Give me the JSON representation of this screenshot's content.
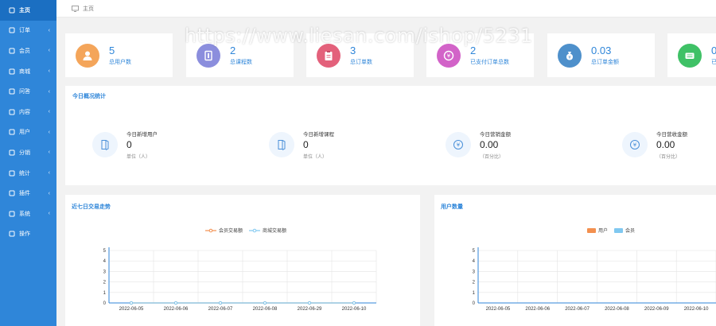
{
  "sidebar": {
    "items": [
      {
        "label": "主页",
        "icon": "home-icon",
        "active": true,
        "arrow": false
      },
      {
        "label": "订单",
        "icon": "list-icon",
        "active": false,
        "arrow": true
      },
      {
        "label": "会员",
        "icon": "user-icon",
        "active": false,
        "arrow": true
      },
      {
        "label": "商城",
        "icon": "tag-icon",
        "active": false,
        "arrow": true
      },
      {
        "label": "问答",
        "icon": "chat-icon",
        "active": false,
        "arrow": true
      },
      {
        "label": "内容",
        "icon": "flag-icon",
        "active": false,
        "arrow": true
      },
      {
        "label": "用户",
        "icon": "person-icon",
        "active": false,
        "arrow": true
      },
      {
        "label": "分销",
        "icon": "send-icon",
        "active": false,
        "arrow": true
      },
      {
        "label": "统计",
        "icon": "gear-icon",
        "active": false,
        "arrow": true
      },
      {
        "label": "插件",
        "icon": "plugin-icon",
        "active": false,
        "arrow": true
      },
      {
        "label": "系统",
        "icon": "settings-icon",
        "active": false,
        "arrow": true
      },
      {
        "label": "操作",
        "icon": "refresh-icon",
        "active": false,
        "arrow": false
      }
    ],
    "arrow_glyph": "‹"
  },
  "breadcrumb": {
    "label": "主页"
  },
  "watermark": "https://www.liesan.com/ishop/5231",
  "stats": [
    {
      "value": "5",
      "label": "总用户数",
      "color": "#f4a55a",
      "icon": "user-avatar-icon"
    },
    {
      "value": "2",
      "label": "总课程数",
      "color": "#8b8edd",
      "icon": "book-icon"
    },
    {
      "value": "3",
      "label": "总订单数",
      "color": "#e3617b",
      "icon": "clipboard-icon"
    },
    {
      "value": "2",
      "label": "已支付订单总数",
      "color": "#d263c8",
      "icon": "coin-icon"
    },
    {
      "value": "0.03",
      "label": "总订单金额",
      "color": "#4e90cb",
      "icon": "money-bag-icon"
    },
    {
      "value": "0",
      "label": "已",
      "color": "#3fc166",
      "icon": "wallet-icon"
    }
  ],
  "today": {
    "title": "今日概况统计",
    "items": [
      {
        "label": "今日新增用户",
        "value": "0",
        "unit": "单位（人）",
        "icon": "door-icon"
      },
      {
        "label": "今日新增课程",
        "value": "0",
        "unit": "单位（人）",
        "icon": "door-icon"
      },
      {
        "label": "今日营销金额",
        "value": "0.00",
        "unit": "（百分比）",
        "icon": "yen-icon"
      },
      {
        "label": "今日营收金额",
        "value": "0.00",
        "unit": "（百分比）",
        "icon": "yen-icon"
      }
    ]
  },
  "charts": {
    "left": {
      "title": "近七日交易走势"
    },
    "right": {
      "title": "用户数量"
    }
  },
  "colors": {
    "sidebar": "#2f86d9",
    "sidebar_active": "#1b6fc2",
    "accent": "#2f86d9",
    "orange": "#f3904f",
    "light_blue": "#80c8f0"
  },
  "chart_data": [
    {
      "type": "line",
      "title": "近七日交易走势",
      "categories": [
        "2022-06-05",
        "2022-06-06",
        "2022-06-07",
        "2022-06-08",
        "2022-06-29",
        "2022-06-10"
      ],
      "series": [
        {
          "name": "会员交易额",
          "color": "#f3904f",
          "values": [
            0,
            0,
            0,
            0,
            0,
            0
          ]
        },
        {
          "name": "商城交易额",
          "color": "#80c8f0",
          "values": [
            0,
            0,
            0,
            0,
            0,
            0
          ]
        }
      ],
      "yticks": [
        "0",
        "1",
        "2",
        "3",
        "4",
        "5"
      ],
      "ylim": [
        0,
        5
      ],
      "grid": true,
      "legend": "top-center"
    },
    {
      "type": "bar",
      "title": "用户数量",
      "categories": [
        "2022-06-05",
        "2022-06-06",
        "2022-06-07",
        "2022-06-08",
        "2022-06-09",
        "2022-06-10"
      ],
      "series": [
        {
          "name": "用户",
          "color": "#f3904f",
          "values": [
            0,
            0,
            0,
            0,
            0,
            0
          ]
        },
        {
          "name": "会员",
          "color": "#80c8f0",
          "values": [
            0,
            0,
            0,
            0,
            0,
            0
          ]
        }
      ],
      "yticks": [
        "0",
        "1",
        "2",
        "3",
        "4",
        "5"
      ],
      "ylim": [
        0,
        5
      ],
      "grid": true,
      "legend": "top-center"
    }
  ]
}
